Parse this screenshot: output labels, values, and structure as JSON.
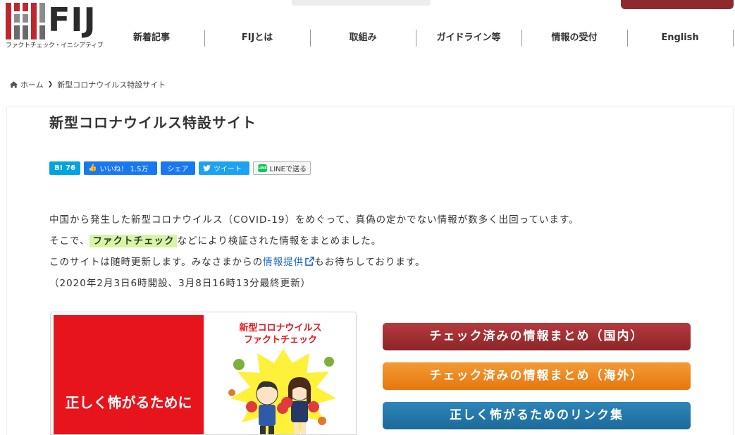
{
  "header": {
    "logo_text": "FIJ",
    "logo_subtitle": "ファクトチェック・イニシアティブ",
    "nav": [
      {
        "label": "新着記事"
      },
      {
        "label": "FIJとは"
      },
      {
        "label": "取組み"
      },
      {
        "label": "ガイドライン等"
      },
      {
        "label": "情報の受付"
      },
      {
        "label": "English"
      }
    ]
  },
  "breadcrumb": {
    "home": "ホーム",
    "current": "新型コロナウイルス特設サイト"
  },
  "page": {
    "title": "新型コロナウイルス特設サイト"
  },
  "share": {
    "hatena_count": "76",
    "fb_like": "いいね！ 1.5万",
    "fb_share": "シェア",
    "tweet": "ツイート",
    "line": "LINEで送る",
    "line_badge": "LINE"
  },
  "intro": {
    "line1": "中国から発生した新型コロナウイルス（COVID-19）をめぐって、真偽の定かでない情報が数多く出回っています。",
    "line2_before": "そこで、",
    "line2_highlight": "ファクトチェック",
    "line2_after": "などにより検証された情報をまとめました。",
    "line3_before": "このサイトは随時更新します。みなさまからの",
    "line3_link": "情報提供",
    "line3_after": "もお待ちしております。",
    "line4": "（2020年2月3日6時開設、3月8日16時13分最終更新）"
  },
  "banner": {
    "red_text": "正しく怖がるために",
    "title_line1": "新型コロナウイルス",
    "title_line2": "ファクトチェック"
  },
  "buttons": {
    "domestic": "チェック済みの情報まとめ（国内）",
    "overseas": "チェック済みの情報まとめ（海外）",
    "links": "正しく怖がるためのリンク集"
  },
  "colors": {
    "brand_red": "#8e2a2e",
    "domestic_btn": "#a3302f",
    "overseas_btn": "#ee8420",
    "links_btn": "#247bab",
    "highlight": "#d6f5a5",
    "link": "#1a66c9"
  }
}
